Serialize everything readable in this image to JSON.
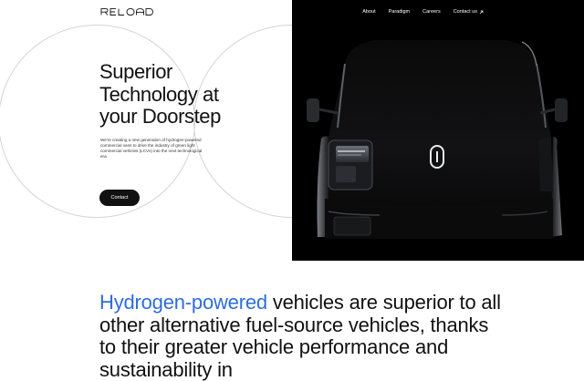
{
  "brand": {
    "logo_text": "RELOAD"
  },
  "nav": {
    "items": [
      {
        "label": "About"
      },
      {
        "label": "Paradigm"
      },
      {
        "label": "Careers"
      },
      {
        "label": "Contact us",
        "icon": "arrow-up-right-icon"
      }
    ]
  },
  "hero": {
    "headline_lines": [
      "Superior",
      "Technology at",
      "your Doorstep"
    ],
    "intro": "We're creating a new generation of hydrogen-powered commercial vans to drive the industry of green light commercial vehicles (LCVs) into the next technological era.",
    "cta_label": "Contact"
  },
  "statement": {
    "highlight": "Hydrogen-powered",
    "rest": " vehicles are superior to all other alternative fuel-source vehicles, thanks to their greater vehicle performance and sustainability in"
  },
  "colors": {
    "accent": "#2e6ddb",
    "text": "#111111",
    "dark_panel": "#000000",
    "button_bg": "#111111"
  }
}
